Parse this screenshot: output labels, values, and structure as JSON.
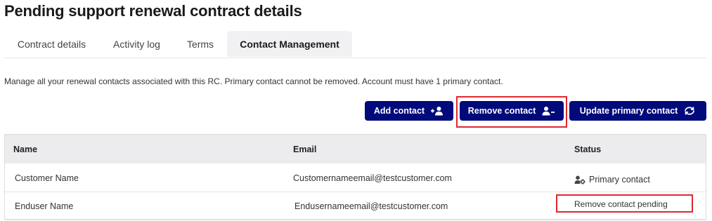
{
  "page": {
    "title": "Pending support renewal contract details"
  },
  "tabs": [
    {
      "label": "Contract details",
      "active": false
    },
    {
      "label": "Activity log",
      "active": false
    },
    {
      "label": "Terms",
      "active": false
    },
    {
      "label": "Contact Management",
      "active": true
    }
  ],
  "description": "Manage all your renewal contacts associated with this RC. Primary contact cannot be removed. Account must have 1 primary contact.",
  "actions": {
    "add_label": "Add contact",
    "add_icon": "person-plus-icon",
    "remove_label": "Remove contact",
    "remove_icon": "person-minus-icon",
    "update_label": "Update primary contact",
    "update_icon": "refresh-icon"
  },
  "table": {
    "columns": [
      "Name",
      "Email",
      "Status"
    ],
    "rows": [
      {
        "name": "Customer Name",
        "email": "Customernameemail@testcustomer.com",
        "status": "Primary contact",
        "status_icon": "primary-contact-icon"
      },
      {
        "name": "Enduser Name",
        "email": "Endusernameemail@testcustomer.com",
        "status": "Remove contact pending",
        "status_icon": ""
      }
    ]
  },
  "colors": {
    "button_bg": "#000a7a",
    "highlight": "#e0282f",
    "header_bg": "#ececee"
  }
}
